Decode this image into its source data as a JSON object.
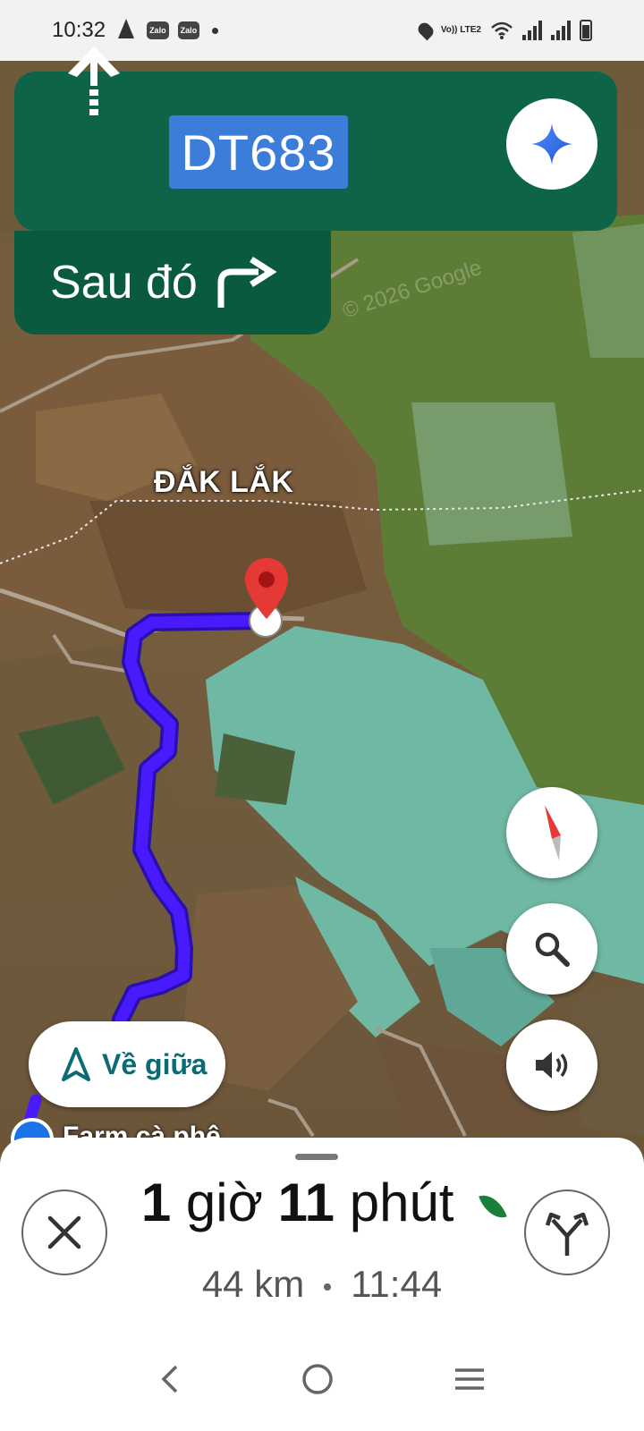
{
  "status_bar": {
    "time": "10:32",
    "notif_1": "Zalo",
    "notif_2": "Zalo",
    "network_label": "Vo)) LTE2"
  },
  "direction": {
    "maneuver": "straight",
    "road": "DT683",
    "then_label": "Sau đó",
    "then_maneuver": "turn-right"
  },
  "map": {
    "province_label": "ĐẮK LẮK",
    "place_label": "Farm cà phê",
    "watermark": "© 2026 Google"
  },
  "buttons": {
    "recenter_label": "Về giữa"
  },
  "trip": {
    "hours": "1",
    "hours_unit": "giờ",
    "minutes": "11",
    "minutes_unit": "phút",
    "distance": "44 km",
    "arrival": "11:44"
  },
  "colors": {
    "nav_green": "#0d6448",
    "route": "#4a1aff",
    "road_badge": "#3b7dd8",
    "recenter_text": "#0b6a74"
  }
}
